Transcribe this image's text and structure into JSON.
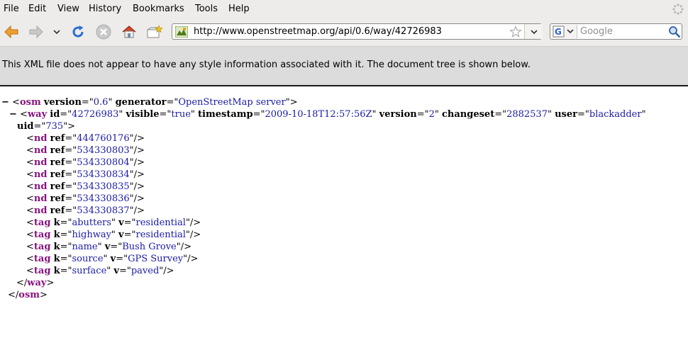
{
  "menu": {
    "file": "File",
    "edit": "Edit",
    "view": "View",
    "history": "History",
    "bookmarks": "Bookmarks",
    "tools": "Tools",
    "help": "Help"
  },
  "nav": {
    "url": "http://www.openstreetmap.org/api/0.6/way/42726983",
    "search_placeholder": "Google"
  },
  "infobar": {
    "message": "This XML file does not appear to have any style information associated with it. The document tree is shown below."
  },
  "xml": {
    "osm": {
      "tag": "osm",
      "version": "0.6",
      "generator": "OpenStreetMap server"
    },
    "way": {
      "tag": "way",
      "id": "42726983",
      "visible": "true",
      "timestamp": "2009-10-18T12:57:56Z",
      "version": "2",
      "changeset": "2882537",
      "user": "blackadder",
      "uid": "735"
    },
    "nds": [
      "444760176",
      "534330803",
      "534330804",
      "534330834",
      "534330835",
      "534330836",
      "534330837"
    ],
    "tags": [
      {
        "k": "abutters",
        "v": "residential"
      },
      {
        "k": "highway",
        "v": "residential"
      },
      {
        "k": "name",
        "v": "Bush Grove"
      },
      {
        "k": "source",
        "v": "GPS Survey"
      },
      {
        "k": "surface",
        "v": "paved"
      }
    ],
    "nd_tag": "nd",
    "tag_tag": "tag",
    "ref_attr": "ref",
    "k_attr": "k",
    "v_attr": "v",
    "collapse_symbol": "−"
  }
}
